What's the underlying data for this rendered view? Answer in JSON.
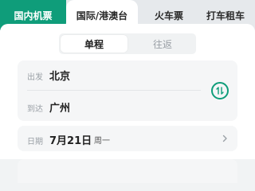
{
  "tabs": [
    {
      "label": "国内机票",
      "active": true
    },
    {
      "label": "国际/港澳台",
      "active": false
    },
    {
      "label": "火车票",
      "active": false
    },
    {
      "label": "打车租车",
      "active": false
    }
  ],
  "trip_type": {
    "options": [
      "单程",
      "往返"
    ],
    "selected": "单程"
  },
  "route": {
    "from_label": "出发",
    "from_city": "北京",
    "to_label": "到达",
    "to_city": "广州",
    "swap_icon": "swap-icon"
  },
  "date": {
    "label": "日期",
    "value": "7月21日",
    "weekday": "周一",
    "chevron_icon": "chevron-right-icon"
  },
  "colors": {
    "accent": "#0f9d7a",
    "tab_bg": "#e6e9ec",
    "card_bg": "#f5f6f7"
  }
}
